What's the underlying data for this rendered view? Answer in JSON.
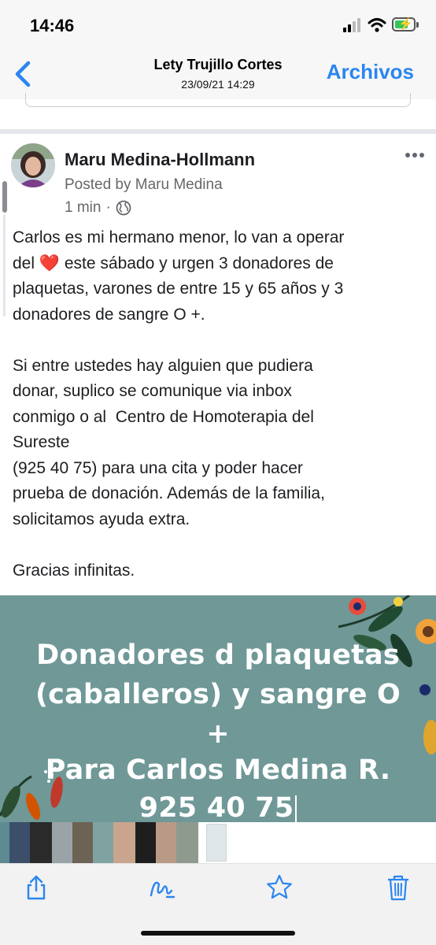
{
  "status_bar": {
    "time": "14:46",
    "icons": [
      "cellular-signal-icon",
      "wifi-icon",
      "battery-charging-icon"
    ]
  },
  "nav": {
    "back_icon": "chevron-left-icon",
    "title": "Lety Trujillo Cortes",
    "subtitle": "23/09/21 14:29",
    "action_label": "Archivos",
    "accent_color": "#2a86f0"
  },
  "post": {
    "author": "Maru Medina-Hollmann",
    "posted_by": "Posted by Maru Medina",
    "time": "1 min",
    "separator": "·",
    "privacy_icon": "globe-icon",
    "more_icon": "more-dots-icon",
    "body_line1_a": "Carlos es mi hermano menor, lo van a operar",
    "body_line2_a": "del",
    "heart": "❤️",
    "body_line2_b": " este sábado y urgen 3 donadores de",
    "body_rest": "plaquetas, varones de entre 15 y 65 años y 3\ndonadores de sangre O +.\n\nSi entre ustedes hay alguien que pudiera\ndonar, suplico se comunique via inbox\nconmigo o al  Centro de Homoterapia del\nSureste\n(925 40 75) para una cita y poder hacer\nprueba de donación. Además de la familia,\nsolicitamos ayuda extra.\n\nGracias infinitas."
  },
  "image": {
    "background_color": "#6f9897",
    "line1": "Donadores d plaquetas",
    "line2": "(caballeros) y sangre O",
    "line3": "+",
    "line4": "Para Carlos Medina R.",
    "line5": "925 40 75"
  },
  "toolbar": {
    "icons": [
      "share-icon",
      "markup-icon",
      "favorite-star-icon",
      "trash-icon"
    ],
    "icon_color": "#2a86f0"
  }
}
